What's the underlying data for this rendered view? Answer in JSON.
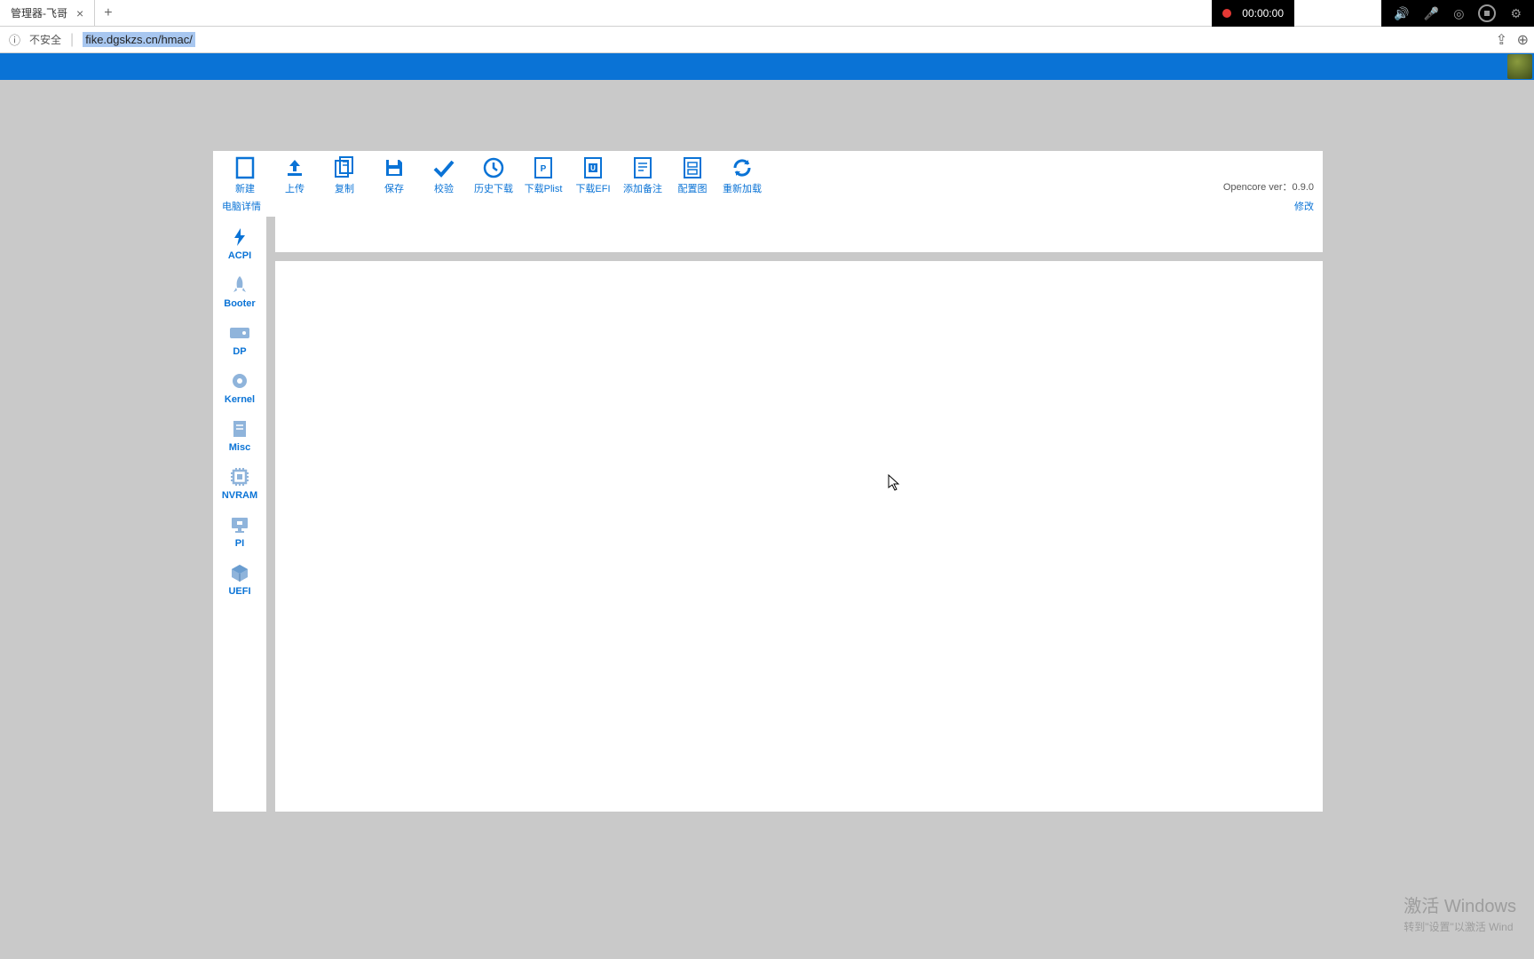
{
  "browser": {
    "tab_title": "管理器-飞哥",
    "insecure_label": "不安全",
    "url": "fike.dgskzs.cn/hmac/"
  },
  "recording": {
    "time": "00:00:00"
  },
  "toolbar": {
    "items": [
      {
        "label": "新建",
        "icon": "doc-icon"
      },
      {
        "label": "上传",
        "icon": "upload-icon"
      },
      {
        "label": "复制",
        "icon": "copy-icon"
      },
      {
        "label": "保存",
        "icon": "save-icon"
      },
      {
        "label": "校验",
        "icon": "check-icon"
      },
      {
        "label": "历史下载",
        "icon": "history-icon"
      },
      {
        "label": "下载Plist",
        "icon": "download-plist-icon"
      },
      {
        "label": "下载EFI",
        "icon": "download-efi-icon"
      },
      {
        "label": "添加备注",
        "icon": "note-icon"
      },
      {
        "label": "配置图",
        "icon": "diagram-icon"
      },
      {
        "label": "重新加载",
        "icon": "reload-icon"
      }
    ],
    "version_label": "Opencore ver：",
    "version_value": "0.9.0"
  },
  "subheader": {
    "left": "电脑详情",
    "right": "修改"
  },
  "sidebar": {
    "items": [
      {
        "label": "ACPI",
        "icon": "bolt-icon"
      },
      {
        "label": "Booter",
        "icon": "rocket-icon"
      },
      {
        "label": "DP",
        "icon": "card-icon"
      },
      {
        "label": "Kernel",
        "icon": "gear-icon"
      },
      {
        "label": "Misc",
        "icon": "doc-small-icon"
      },
      {
        "label": "NVRAM",
        "icon": "chip-icon"
      },
      {
        "label": "PI",
        "icon": "monitor-icon"
      },
      {
        "label": "UEFI",
        "icon": "cube-icon"
      }
    ]
  },
  "watermark": {
    "line1": "激活 Windows",
    "line2": "转到\"设置\"以激活 Wind"
  }
}
